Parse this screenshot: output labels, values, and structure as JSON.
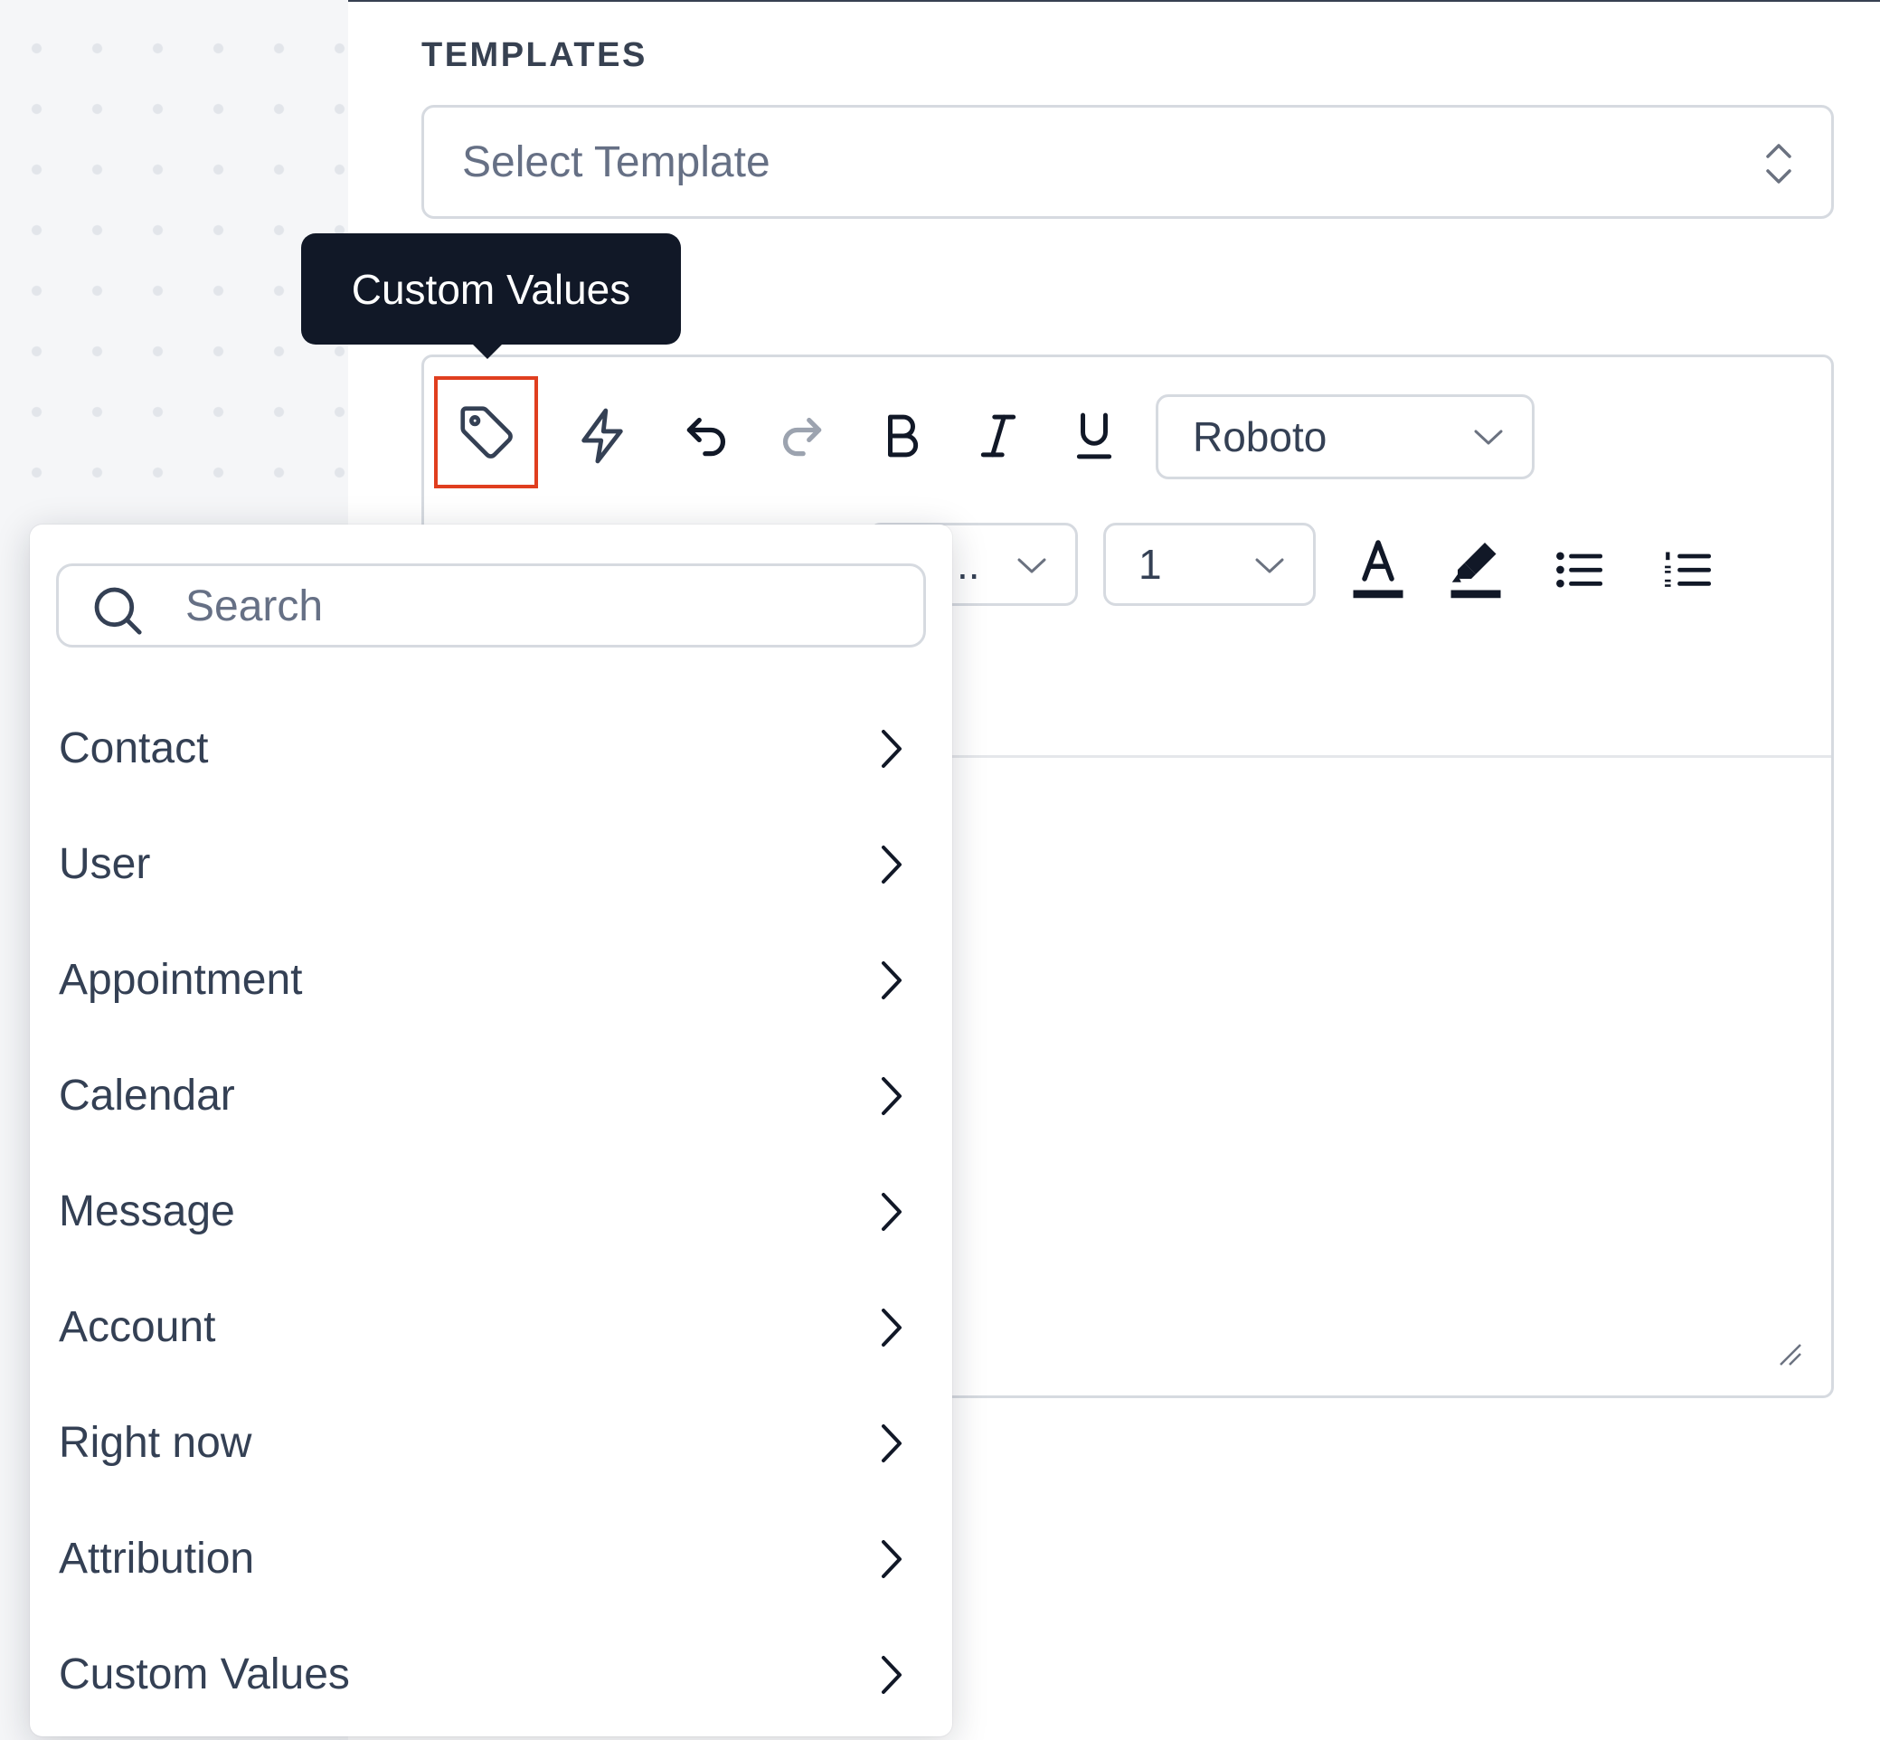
{
  "templates": {
    "label": "TEMPLATES",
    "select_placeholder": "Select Template"
  },
  "tooltip": {
    "text": "Custom Values"
  },
  "toolbar": {
    "row1": [
      "tag-icon",
      "lightning-icon",
      "undo-icon",
      "redo-icon",
      "bold-icon",
      "italic-icon",
      "underline-icon"
    ],
    "font_family": "Roboto",
    "font_size": "1",
    "font_family_2_truncated": "..",
    "row2": [
      "text-color-icon",
      "highlight-icon",
      "bullet-list-icon",
      "numbered-list-icon"
    ]
  },
  "custom_values_menu": {
    "search_placeholder": "Search",
    "items": [
      {
        "label": "Contact"
      },
      {
        "label": "User"
      },
      {
        "label": "Appointment"
      },
      {
        "label": "Calendar"
      },
      {
        "label": "Message"
      },
      {
        "label": "Account"
      },
      {
        "label": "Right now"
      },
      {
        "label": "Attribution"
      },
      {
        "label": "Custom Values"
      }
    ]
  },
  "colors": {
    "tag_highlight": "#e03e1f",
    "tooltip_bg": "#111827",
    "border": "#d6dae0",
    "text": "#344054"
  }
}
